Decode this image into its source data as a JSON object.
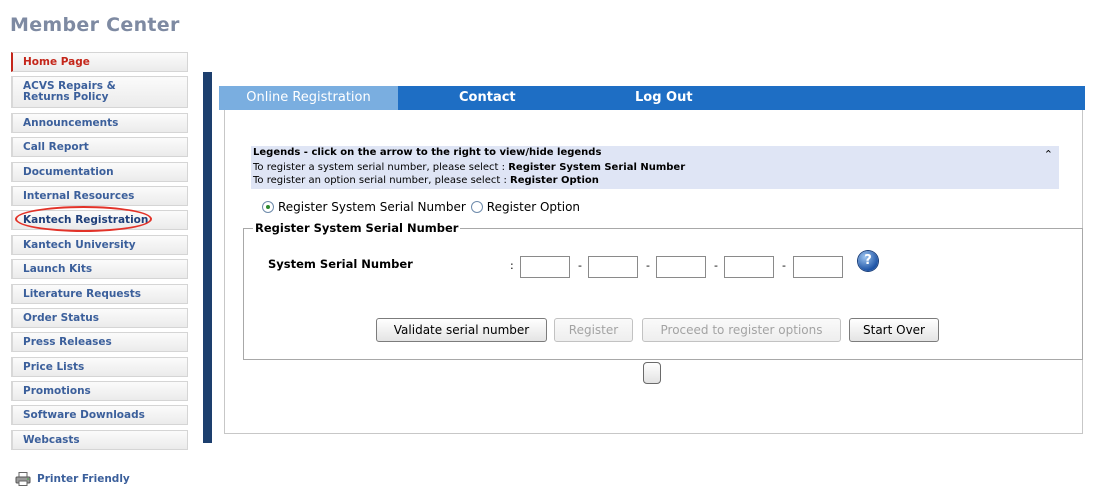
{
  "page_title": "Member Center",
  "sidebar": {
    "items": [
      {
        "label": "Home Page",
        "state": "active"
      },
      {
        "label_line1": "ACVS Repairs &",
        "label_line2": "Returns Policy"
      },
      {
        "label": "Announcements"
      },
      {
        "label": "Call Report"
      },
      {
        "label": "Documentation"
      },
      {
        "label": "Internal Resources"
      },
      {
        "label": "Kantech Registration",
        "highlighted": true
      },
      {
        "label": "Kantech University"
      },
      {
        "label": "Launch Kits"
      },
      {
        "label": "Literature Requests"
      },
      {
        "label": "Order Status"
      },
      {
        "label": "Press Releases"
      },
      {
        "label": "Price Lists"
      },
      {
        "label": "Promotions"
      },
      {
        "label": "Software Downloads"
      },
      {
        "label": "Webcasts"
      }
    ]
  },
  "printer_friendly": {
    "label": "Printer Friendly",
    "icon": "printer-icon"
  },
  "tabs": [
    {
      "label": "Online Registration",
      "active": true
    },
    {
      "label": "Contact"
    },
    {
      "label": "Log Out"
    }
  ],
  "legend": {
    "title": "Legends - click on the arrow to the right to view/hide legends",
    "line1_prefix": "To register a system serial number, please select :",
    "line1_bold": "Register System Serial Number",
    "line2_prefix": "To register an option serial number, please select :",
    "line2_bold": "Register Option",
    "toggle_icon": "collapse-arrows-icon"
  },
  "registration_type": {
    "options": [
      "Register System Serial Number",
      "Register Option"
    ],
    "selected": "Register System Serial Number"
  },
  "system_serial": {
    "section_title": "Register System Serial Number",
    "field_label": "System Serial Number",
    "separator": ":",
    "dash": "-",
    "segments": [
      "",
      "",
      "",
      "",
      ""
    ],
    "help_icon": "help-icon"
  },
  "buttons": {
    "validate": "Validate serial number",
    "register": "Register",
    "proceed": "Proceed to register options",
    "start_over": "Start Over"
  },
  "colors": {
    "tab_bar": "#1e6ec4",
    "tab_active": "#7aaee0",
    "sidebar_link": "#3b5f9b",
    "active_link": "#c4261a",
    "legend_bg": "#dfe5f5",
    "highlight_ellipse": "#e23228"
  }
}
